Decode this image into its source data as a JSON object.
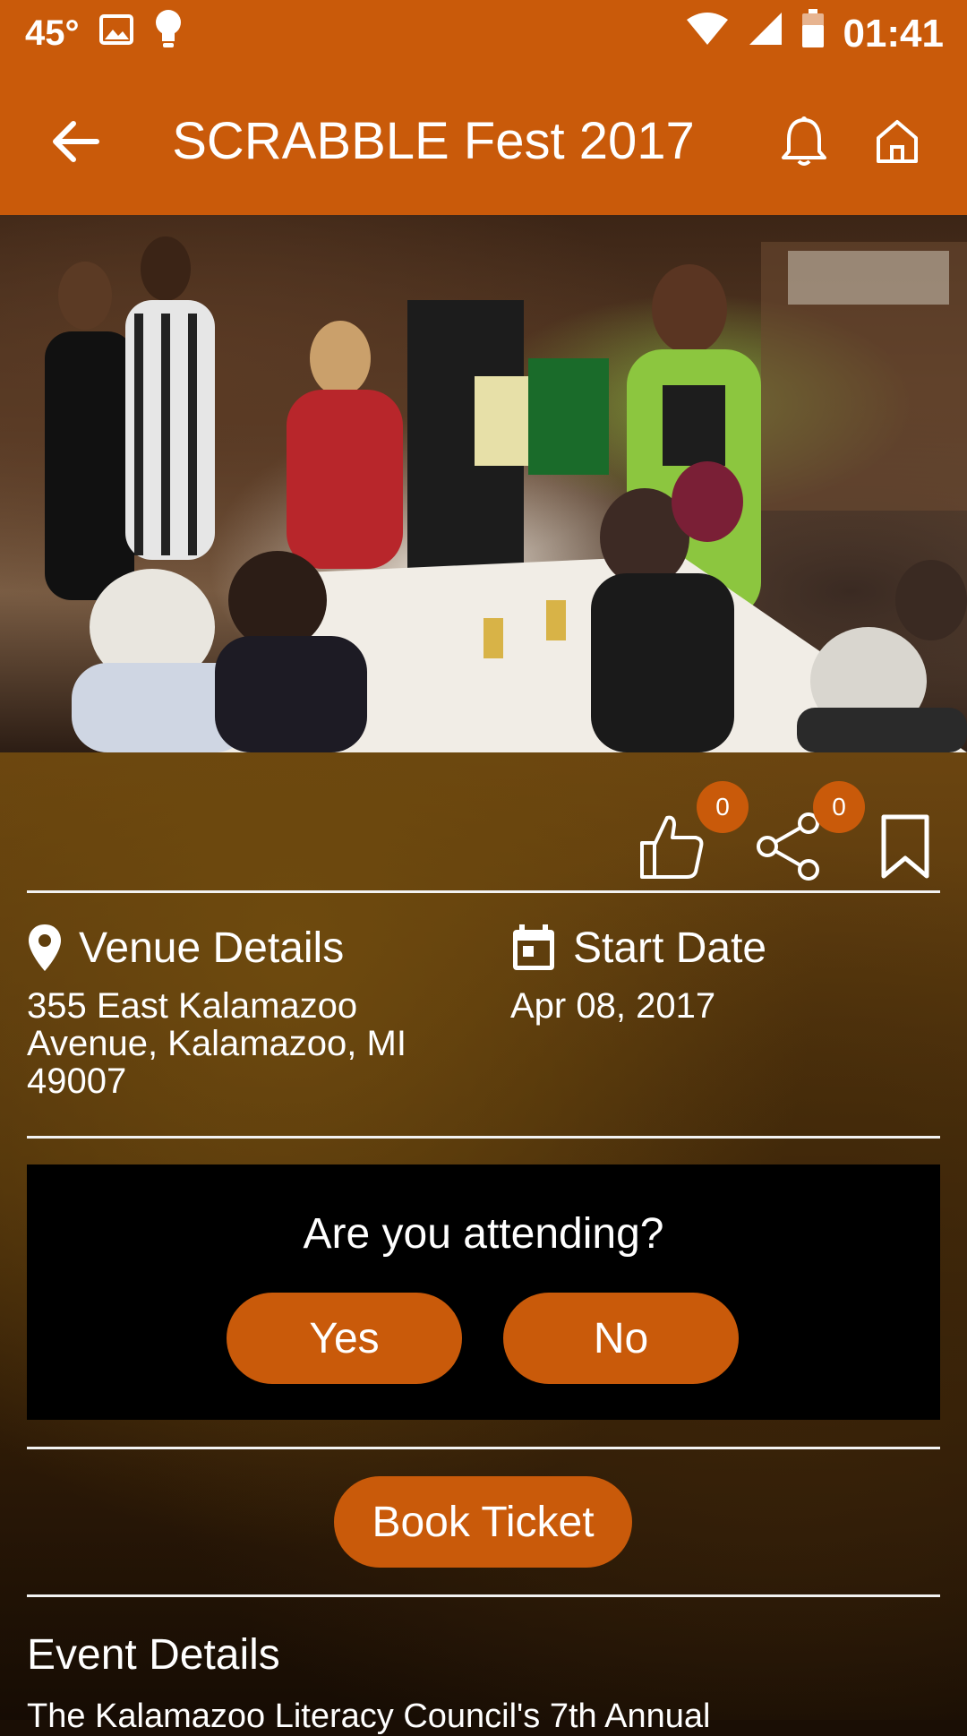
{
  "status": {
    "temperature": "45°",
    "time": "01:41"
  },
  "app_bar": {
    "title": "SCRABBLE Fest 2017"
  },
  "social": {
    "like_count": "0",
    "share_count": "0"
  },
  "venue": {
    "heading": "Venue Details",
    "address": "355 East Kalamazoo Avenue, Kalamazoo, MI 49007"
  },
  "date": {
    "heading": "Start Date",
    "value": "Apr 08, 2017"
  },
  "attend": {
    "question": "Are you attending?",
    "yes_label": "Yes",
    "no_label": "No"
  },
  "ticket": {
    "label": "Book Ticket"
  },
  "event_details": {
    "heading": "Event Details",
    "description": "The Kalamazoo Literacy Council's 7th Annual"
  },
  "colors": {
    "accent": "#c95a0a",
    "attend_box": "#000000"
  }
}
